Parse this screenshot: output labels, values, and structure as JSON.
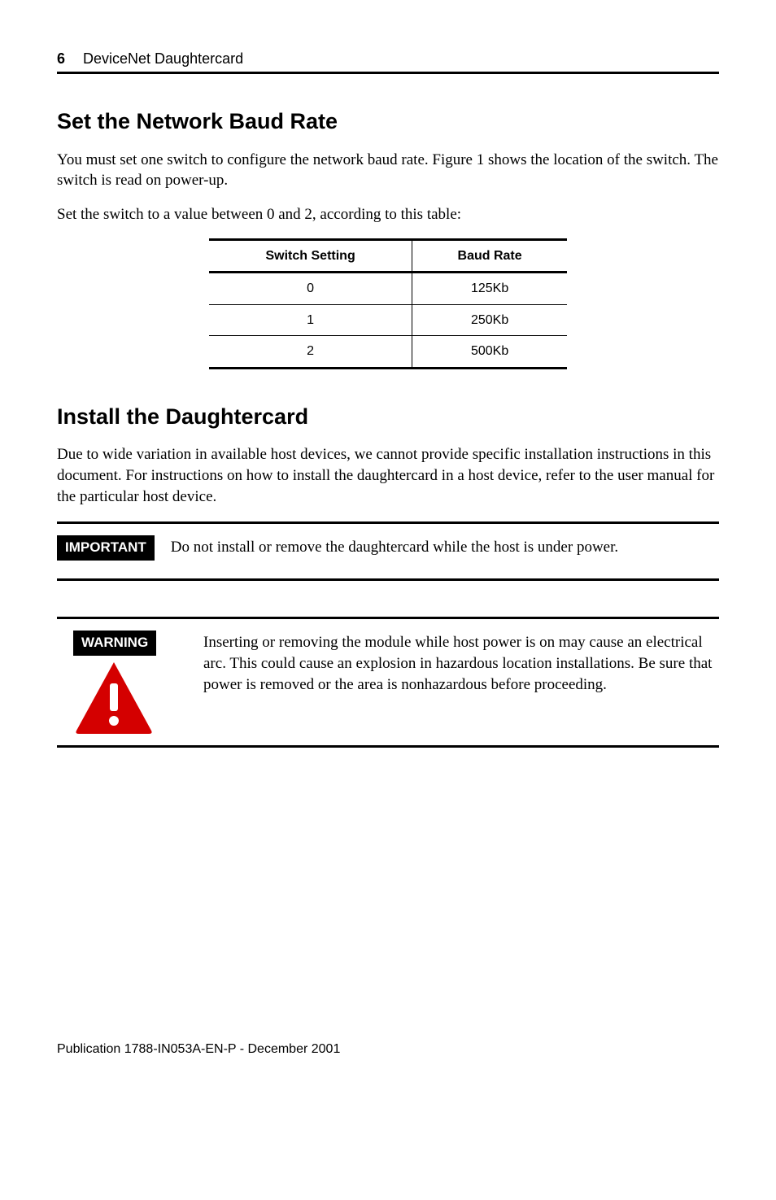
{
  "header": {
    "page_number": "6",
    "title": "DeviceNet Daughtercard"
  },
  "sections": {
    "baud": {
      "heading": "Set the Network Baud Rate",
      "para1": "You must set one switch to configure the network baud rate. Figure 1 shows the location of the switch. The switch is read on power-up.",
      "para2": "Set the switch to a value between 0 and 2, according to this table:",
      "table": {
        "col1": "Switch Setting",
        "col2": "Baud Rate",
        "rows": [
          {
            "setting": "0",
            "rate": "125Kb"
          },
          {
            "setting": "1",
            "rate": "250Kb"
          },
          {
            "setting": "2",
            "rate": "500Kb"
          }
        ]
      }
    },
    "install": {
      "heading": "Install the Daughtercard",
      "para1": "Due to wide variation in available host devices, we cannot provide specific installation instructions in this document. For instructions on how to install the daughtercard in a host device, refer to the user manual for the particular host device."
    },
    "important": {
      "label": "IMPORTANT",
      "text": "Do not install or remove the daughtercard while the host is under power."
    },
    "warning": {
      "label": "WARNING",
      "text": "Inserting or removing the module while host power is on may cause an electrical arc. This could cause an explosion in hazardous location installations. Be sure that power is removed or the area is nonhazardous before proceeding."
    }
  },
  "footer": {
    "text": "Publication 1788-IN053A-EN-P - December 2001"
  },
  "icons": {
    "warning_triangle": "warning-triangle-icon"
  }
}
